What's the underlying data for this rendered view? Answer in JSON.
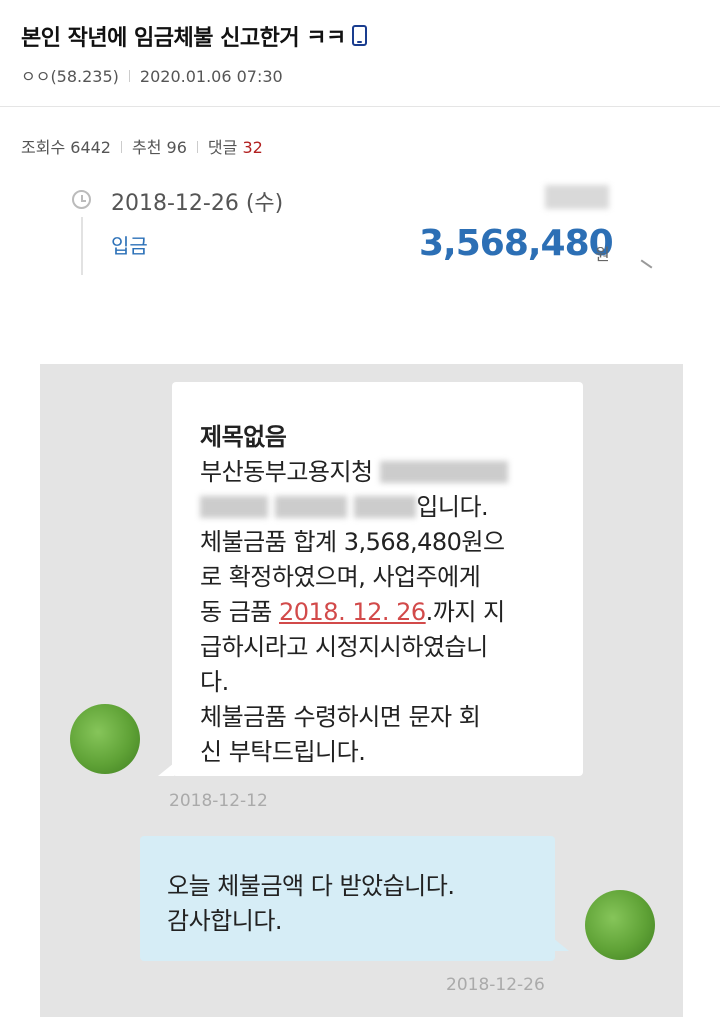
{
  "post": {
    "title": "본인 작년에 임금체불 신고한거 ㅋㅋ",
    "author": "ㅇㅇ(58.235)",
    "datetime": "2020.01.06 07:30",
    "views_label": "조회수",
    "views": "6442",
    "recommend_label": "추천",
    "recommend": "96",
    "comments_label": "댓글",
    "comments": "32"
  },
  "transaction": {
    "date": "2018-12-26 (수)",
    "type": "입금",
    "amount": "3,568,480",
    "unit": "원"
  },
  "sms": {
    "received": {
      "subject": "제목없음",
      "line1_prefix": "부산동부고용지청",
      "line2_suffix": "입니다.",
      "line3": "체불금품 합계 3,568,480원으",
      "line4": "로 확정하였으며, 사업주에게",
      "line5_prefix": "동 금품 ",
      "line5_date": "2018. 12. 26",
      "line5_suffix": ".까지 지",
      "line6": "급하시라고 시정지시하였습니",
      "line7": "다.",
      "line8": "체불금품 수령하시면 문자 회",
      "line9": "신 부탁드립니다.",
      "timestamp": "2018-12-12"
    },
    "sent": {
      "line1": "오늘 체불금액 다 받았습니다.",
      "line2": "감사합니다.",
      "timestamp": "2018-12-26"
    }
  },
  "colors": {
    "amount": "#2c6fb5",
    "deposit_label": "#2c71b8",
    "date_link": "#d24a4a",
    "comment_count": "#b22020",
    "sent_bubble": "#d6edf6",
    "sms_background": "#e4e4e4"
  },
  "icons": [
    "mobile-icon",
    "clock-icon"
  ]
}
